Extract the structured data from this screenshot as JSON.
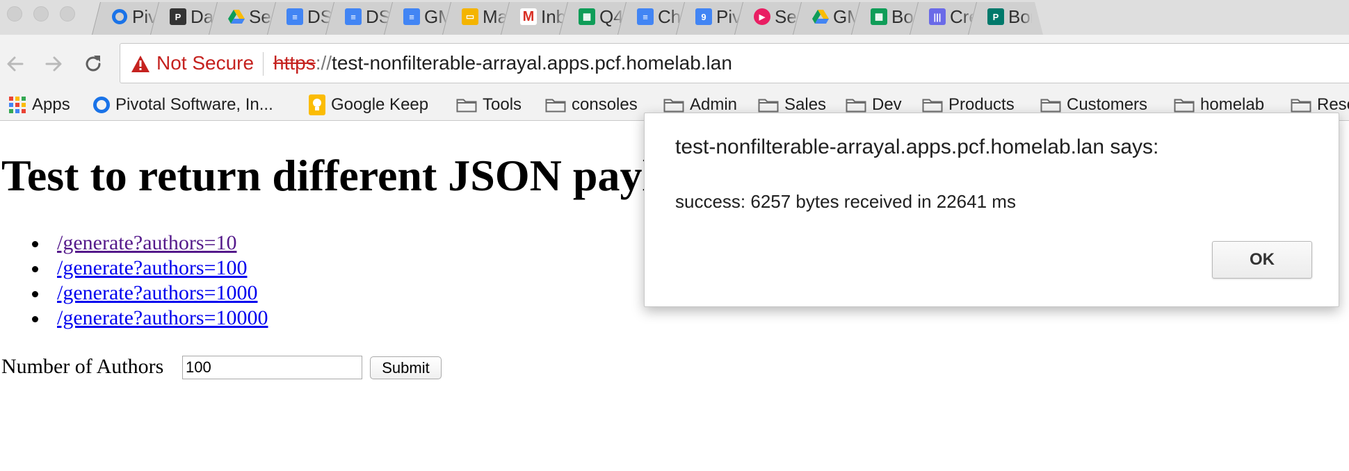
{
  "tabs": [
    {
      "title": "Piv",
      "icon": "pivotal-ring-icon",
      "color": "#1a73e8",
      "glyph": ""
    },
    {
      "title": "Das",
      "icon": "pivotal-p-icon",
      "color": "#333333",
      "glyph": "P"
    },
    {
      "title": "Sea",
      "icon": "google-drive-icon",
      "color": "#fbbc04",
      "glyph": ""
    },
    {
      "title": "DSI",
      "icon": "google-docs-icon",
      "color": "#4285f4",
      "glyph": "≡"
    },
    {
      "title": "DS(",
      "icon": "google-docs-icon",
      "color": "#4285f4",
      "glyph": "≡"
    },
    {
      "title": "GM",
      "icon": "google-docs-icon",
      "color": "#4285f4",
      "glyph": "≡"
    },
    {
      "title": "Mai",
      "icon": "google-slides-icon",
      "color": "#f4b400",
      "glyph": "▭"
    },
    {
      "title": "Inb",
      "icon": "gmail-icon",
      "color": "#ffffff",
      "glyph": "M"
    },
    {
      "title": "Q4",
      "icon": "google-sheets-icon",
      "color": "#0f9d58",
      "glyph": "▦"
    },
    {
      "title": "Cha",
      "icon": "google-docs-icon",
      "color": "#4285f4",
      "glyph": "≡"
    },
    {
      "title": "Piv",
      "icon": "google-calendar-icon",
      "color": "#4285f4",
      "glyph": "9"
    },
    {
      "title": "Sea",
      "icon": "play-circle-icon",
      "color": "#e91e63",
      "glyph": "▶"
    },
    {
      "title": "GM",
      "icon": "google-drive-icon",
      "color": "#fbbc04",
      "glyph": ""
    },
    {
      "title": "Boc",
      "icon": "google-sheets-icon",
      "color": "#0f9d58",
      "glyph": "▦"
    },
    {
      "title": "Cre",
      "icon": "barcode-icon",
      "color": "#6a6ae8",
      "glyph": "|||"
    },
    {
      "title": "Bon",
      "icon": "pivotal-p-icon",
      "color": "#00796b",
      "glyph": "P"
    }
  ],
  "address_bar": {
    "security_label": "Not Secure",
    "scheme": "https",
    "separator": "://",
    "host": "test-nonfilterable-arrayal.apps.pcf.homelab.lan"
  },
  "bookmarks": [
    {
      "label": "Apps",
      "icon": "apps-grid-icon"
    },
    {
      "label": "Pivotal Software, In...",
      "icon": "pivotal-ring-icon"
    },
    {
      "label": "Google Keep",
      "icon": "keep-bulb-icon"
    },
    {
      "label": "Tools",
      "icon": "folder-icon"
    },
    {
      "label": "consoles",
      "icon": "folder-icon"
    },
    {
      "label": "Admin",
      "icon": "folder-icon"
    },
    {
      "label": "Sales",
      "icon": "folder-icon"
    },
    {
      "label": "Dev",
      "icon": "folder-icon"
    },
    {
      "label": "Products",
      "icon": "folder-icon"
    },
    {
      "label": "Customers",
      "icon": "folder-icon"
    },
    {
      "label": "homelab",
      "icon": "folder-icon"
    },
    {
      "label": "Rese",
      "icon": "folder-icon"
    }
  ],
  "page": {
    "title": "Test to return different JSON payloads",
    "links": [
      {
        "text": "/generate?authors=10",
        "visited": true
      },
      {
        "text": "/generate?authors=100",
        "visited": false
      },
      {
        "text": "/generate?authors=1000",
        "visited": false
      },
      {
        "text": "/generate?authors=10000",
        "visited": false
      }
    ],
    "form": {
      "label": "Number of Authors",
      "value": "100",
      "submit_label": "Submit"
    }
  },
  "dialog": {
    "title": "test-nonfilterable-arrayal.apps.pcf.homelab.lan says:",
    "message": "success: 6257 bytes received in 22641 ms",
    "ok_label": "OK"
  },
  "colors": {
    "link": "#0000ee",
    "visited_link": "#551a8b",
    "insecure_red": "#c5221f"
  }
}
